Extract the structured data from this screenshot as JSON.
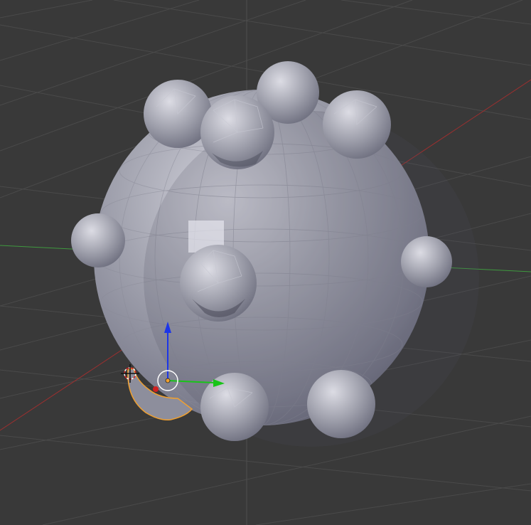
{
  "viewport": {
    "background": "#393939",
    "grid_color": "#4a4a4a",
    "axis_x_color": "#9c2f2f",
    "axis_y_color": "#3f9a3f",
    "axis_z_color": "#4a4a4a"
  },
  "mesh": {
    "base_color": "#a7a8b3",
    "shadow_color": "#5f6070",
    "highlight_color": "#e2e2e8",
    "selection_color": "#f0a030"
  },
  "gizmo": {
    "z_arrow_color": "#1c36e8",
    "y_arrow_color": "#18c418",
    "x_dot_color": "#d02020",
    "pivot_color": "#ffffff",
    "origin_color": "#f0a030"
  },
  "icons": [
    "3d-cursor-icon",
    "object-origin-icon",
    "transform-gizmo-icon"
  ]
}
